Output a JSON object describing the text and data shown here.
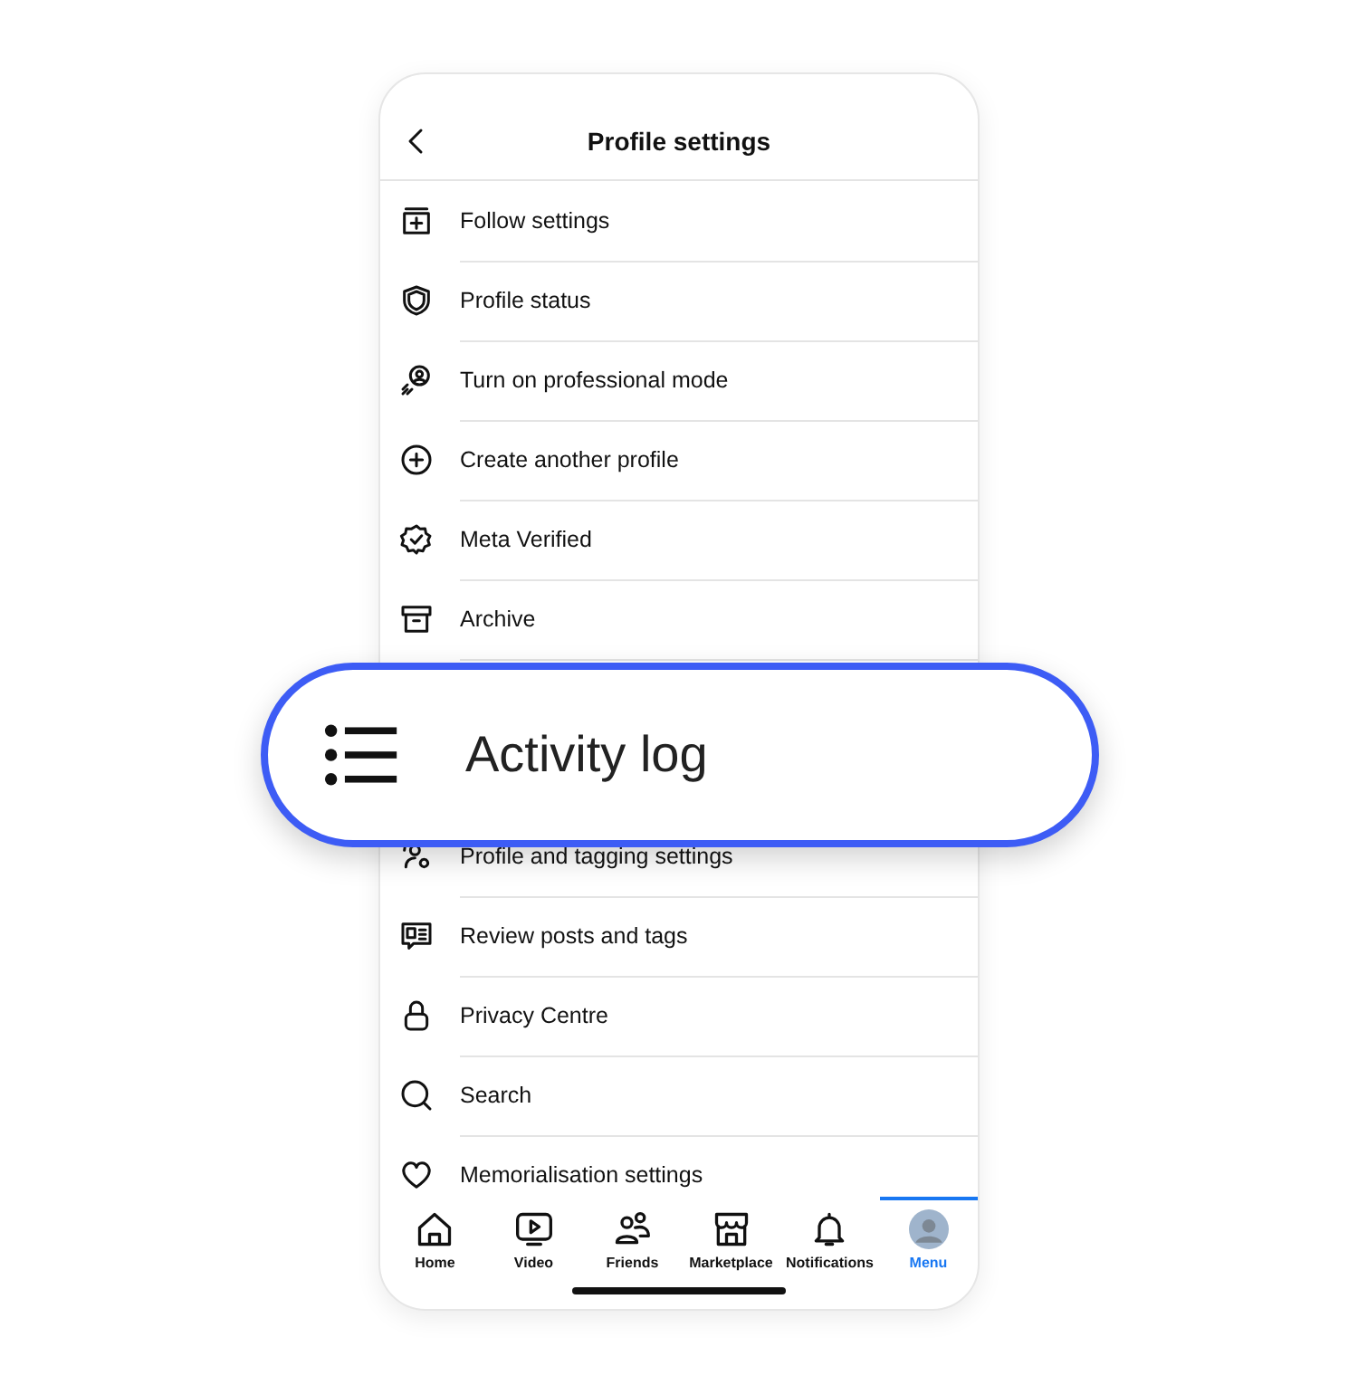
{
  "header": {
    "title": "Profile settings"
  },
  "items": [
    {
      "label": "Follow settings"
    },
    {
      "label": "Profile status"
    },
    {
      "label": "Turn on professional mode"
    },
    {
      "label": "Create another profile"
    },
    {
      "label": "Meta Verified"
    },
    {
      "label": "Archive"
    }
  ],
  "callout": {
    "label": "Activity log"
  },
  "items_below": [
    {
      "label": "Profile and tagging settings"
    },
    {
      "label": "Review posts and tags"
    },
    {
      "label": "Privacy Centre"
    },
    {
      "label": "Search"
    },
    {
      "label": "Memorialisation settings"
    }
  ],
  "tabs": [
    {
      "label": "Home",
      "selected": false
    },
    {
      "label": "Video",
      "selected": false
    },
    {
      "label": "Friends",
      "selected": false
    },
    {
      "label": "Marketplace",
      "selected": false
    },
    {
      "label": "Notifications",
      "selected": false
    },
    {
      "label": "Menu",
      "selected": true
    }
  ]
}
